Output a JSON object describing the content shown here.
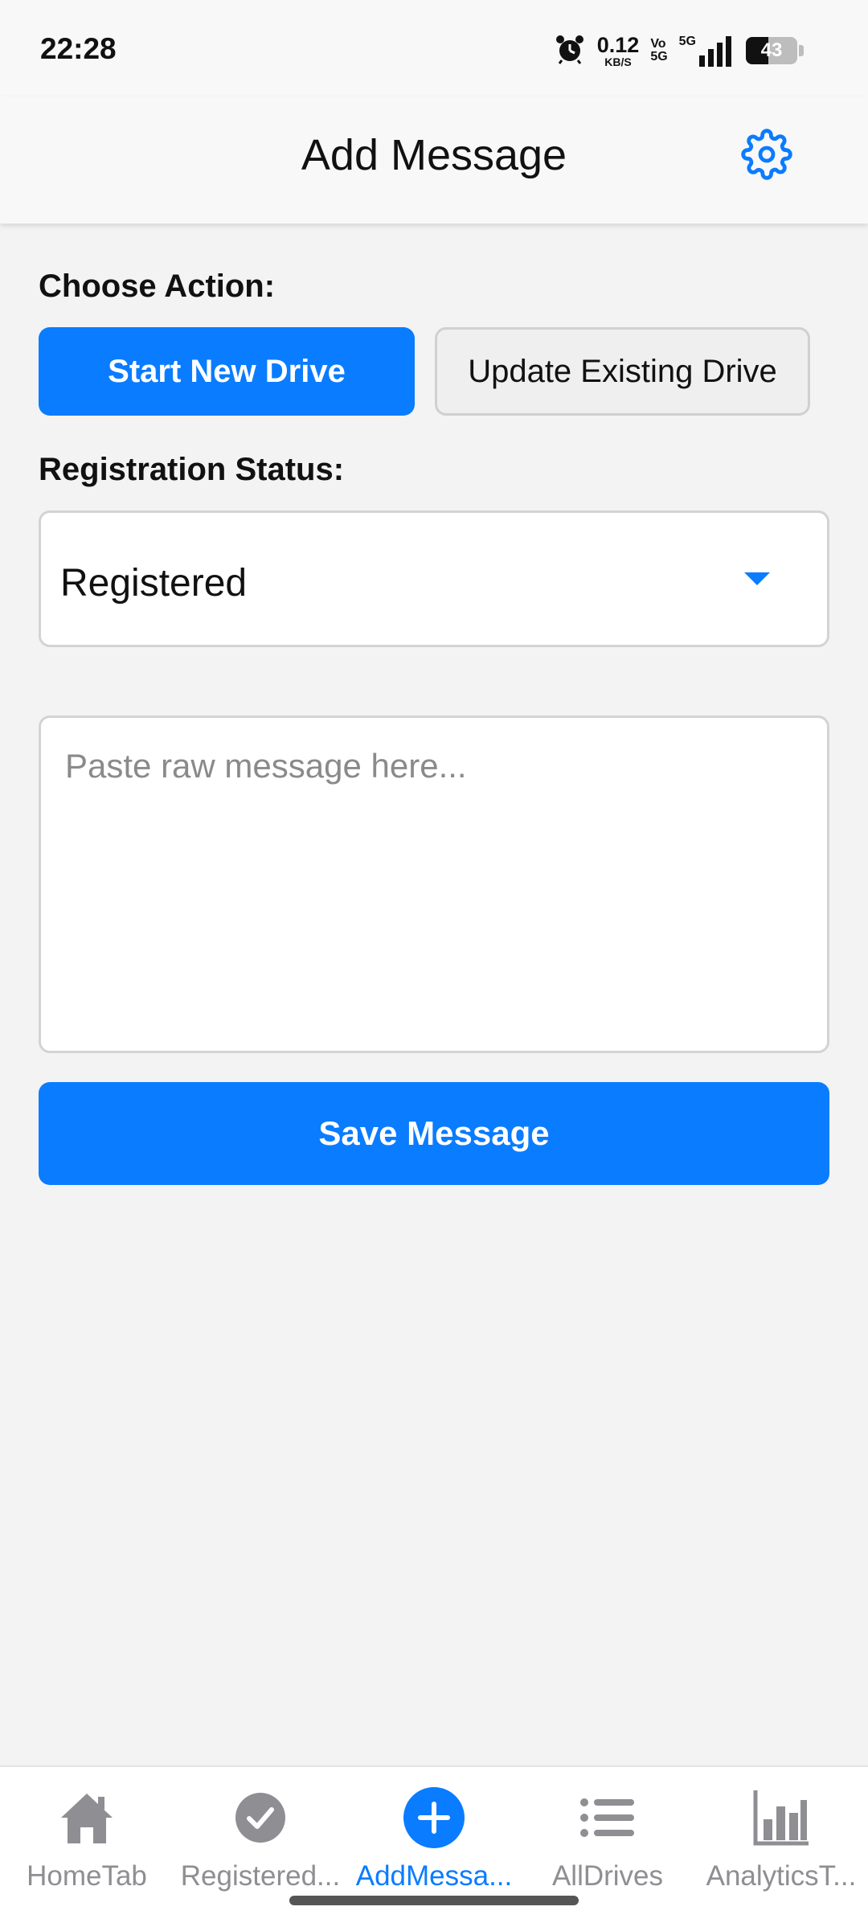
{
  "status_bar": {
    "time": "22:28",
    "net_speed_value": "0.12",
    "net_speed_unit": "KB/S",
    "volte_top": "Vo",
    "volte_bottom": "5G",
    "signal_type": "5G",
    "battery_level": "43",
    "icons": [
      "alarm-icon",
      "signal-icon",
      "battery-icon"
    ]
  },
  "header": {
    "title": "Add Message",
    "settings_icon": "gear-icon"
  },
  "choose_action": {
    "label": "Choose Action:",
    "options": [
      {
        "label": "Start New Drive",
        "selected": true
      },
      {
        "label": "Update Existing Drive",
        "selected": false
      }
    ]
  },
  "registration": {
    "label": "Registration Status:",
    "selected_value": "Registered"
  },
  "message_input": {
    "value": "",
    "placeholder": "Paste raw message here..."
  },
  "save_button": {
    "label": "Save Message"
  },
  "tabs": [
    {
      "label": "HomeTab",
      "icon": "home-icon",
      "active": false
    },
    {
      "label": "Registered...",
      "icon": "check-circle-icon",
      "active": false
    },
    {
      "label": "AddMessa...",
      "icon": "plus-circle-icon",
      "active": true
    },
    {
      "label": "AllDrives",
      "icon": "list-icon",
      "active": false
    },
    {
      "label": "AnalyticsT...",
      "icon": "bar-chart-icon",
      "active": false
    }
  ],
  "colors": {
    "accent": "#0a7cff",
    "inactive_tab": "#8e8e93",
    "background": "#f3f3f3"
  }
}
